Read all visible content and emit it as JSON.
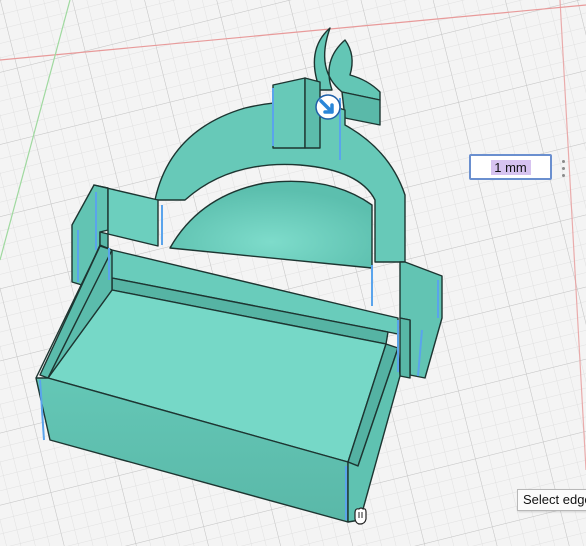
{
  "dimension_input": {
    "value": "1 mm"
  },
  "tooltip": {
    "text": "Select edge"
  },
  "icons": {
    "move": "blue-arrow-move-icon",
    "cursor": "edge-select-cursor-icon",
    "more": "vertical-dots-icon"
  },
  "colors": {
    "model_fill": "#6ed1c1",
    "model_edge": "#1f3a36",
    "selected_edge": "#5aa0e8",
    "grid_minor": "#dedede",
    "grid_major": "#c8c8c8",
    "axis_red": "#e58a8a",
    "axis_green": "#8bd08b",
    "input_border": "#6a8fcf"
  }
}
